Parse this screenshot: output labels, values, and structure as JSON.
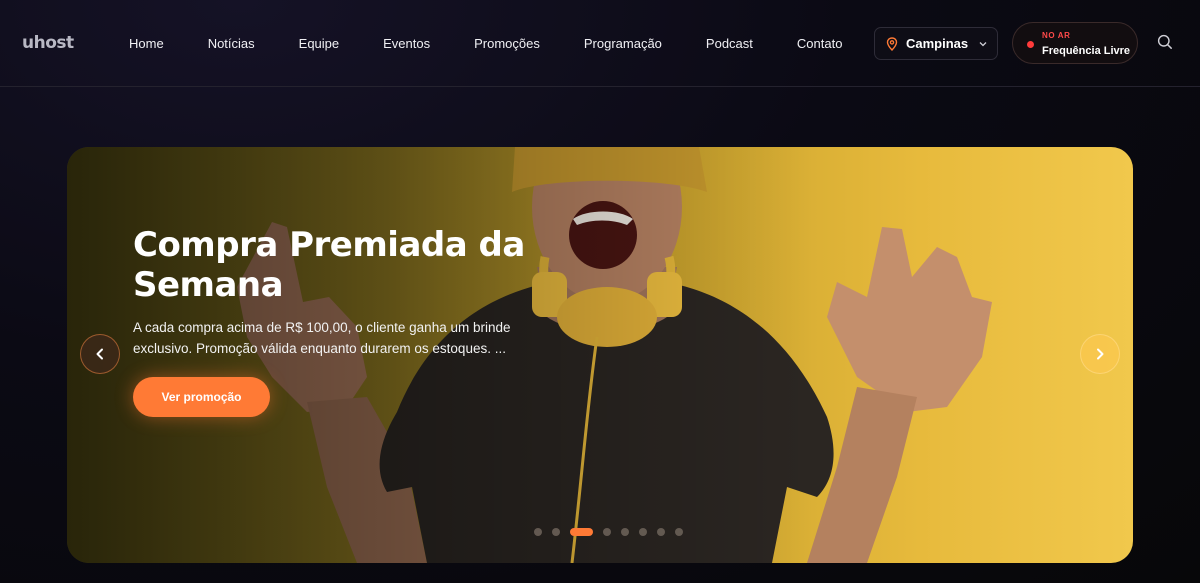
{
  "brand": {
    "logo_text": "uhost"
  },
  "nav": {
    "items": [
      {
        "label": "Home"
      },
      {
        "label": "Notícias"
      },
      {
        "label": "Equipe"
      },
      {
        "label": "Eventos"
      },
      {
        "label": "Promoções"
      },
      {
        "label": "Programação"
      },
      {
        "label": "Podcast"
      },
      {
        "label": "Contato"
      }
    ]
  },
  "city_selector": {
    "value": "Campinas"
  },
  "live": {
    "status": "NO AR",
    "station": "Frequência Livre"
  },
  "hero": {
    "title": "Compra Premiada da Semana",
    "description": "A cada compra acima de R$ 100,00, o cliente ganha um brinde exclusivo. Promoção válida enquanto durarem os estoques. ...",
    "cta_label": "Ver promoção",
    "slide_count": 8,
    "active_slide": 3
  },
  "colors": {
    "accent": "#ff7a35",
    "live_red": "#ff3b3b",
    "background": "#0b0a14"
  }
}
